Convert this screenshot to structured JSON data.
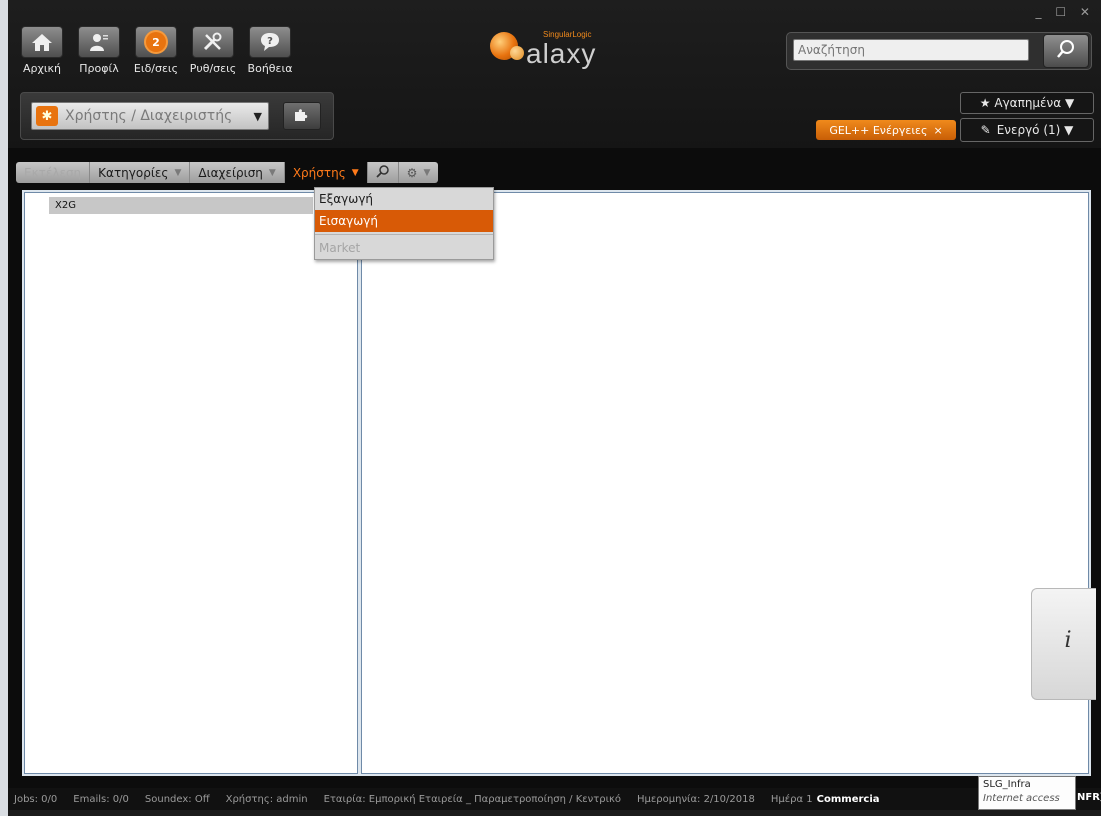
{
  "nav": [
    {
      "label": "Αρχική",
      "icon": "home-icon"
    },
    {
      "label": "Προφίλ",
      "icon": "profile-icon"
    },
    {
      "label": "Ειδ/σεις",
      "icon": "notifications-icon",
      "badge": "2"
    },
    {
      "label": "Ρυθ/σεις",
      "icon": "tools-icon"
    },
    {
      "label": "Βοήθεια",
      "icon": "help-icon"
    }
  ],
  "role": {
    "label": "Χρήστης / Διαχειριστής"
  },
  "logo": {
    "small": "SingularLogic",
    "text": "alaxy"
  },
  "search": {
    "placeholder": "Αναζήτηση"
  },
  "favorites": {
    "label": "★ Αγαπημένα ▼"
  },
  "gel": {
    "label": "GEL++ Ενέργειες",
    "close": "×"
  },
  "active": {
    "label": "Ενεργό (1) ▼"
  },
  "toolbar": {
    "execute": "Εκτέλεση",
    "categories": "Κατηγορίες",
    "admin": "Διαχείριση",
    "user": "Χρήστης"
  },
  "dropdown": {
    "export": "Εξαγωγή",
    "import": "Εισαγωγή",
    "market": "Market"
  },
  "tree": {
    "row1": "X2G"
  },
  "status": {
    "jobs": "Jobs: 0/0",
    "emails": "Emails: 0/0",
    "soundex": "Soundex: Off",
    "user": "Χρήστης: admin",
    "company": "Εταιρία: Εμπορική Εταιρεία _ Παραμετροποίηση / Κεντρικό",
    "date": "Ημερομηνία: 2/10/2018",
    "day": "Ημέρα 1",
    "commercial": "Commercia",
    "tail": "NFR]"
  },
  "tooltip": {
    "line1": "SLG_Infra",
    "line2": "Internet access"
  },
  "colors": {
    "accent": "#e8730f",
    "background": "#0c0c0c"
  }
}
